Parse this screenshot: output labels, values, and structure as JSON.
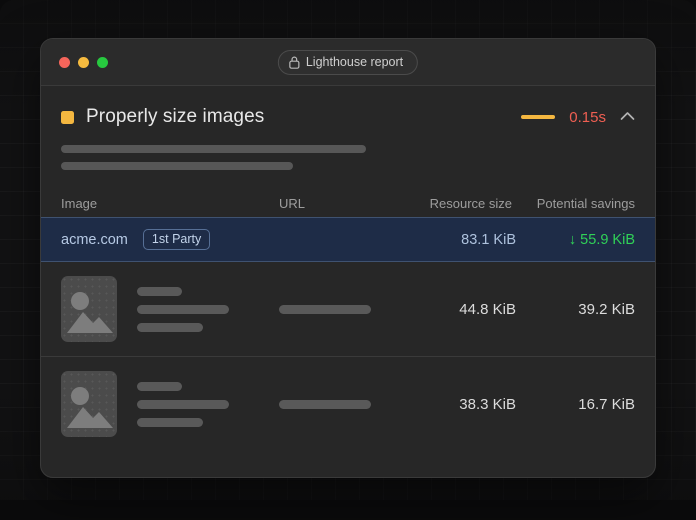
{
  "window": {
    "traffic_lights": [
      {
        "name": "close",
        "color": "#f5655b"
      },
      {
        "name": "minimize",
        "color": "#f6bb3f"
      },
      {
        "name": "zoom",
        "color": "#27c93f"
      }
    ],
    "url_pill": {
      "icon": "lock-icon",
      "label": "Lighthouse report"
    }
  },
  "audit": {
    "bullet_color": "#f4b740",
    "title": "Properly size images",
    "indicator_color": "#f4b740",
    "metric": "0.15s",
    "metric_color": "#ef5f52",
    "toggle_icon": "chevron-up-icon",
    "description_placeholder_lines": 2
  },
  "table": {
    "columns": {
      "image": "Image",
      "url": "URL",
      "resource_size": "Resource size",
      "potential_savings": "Potential savings"
    },
    "summary_row": {
      "host": "acme.com",
      "party_badge": "1st Party",
      "resource_size": "83.1 KiB",
      "potential_savings": "↓ 55.9 KiB",
      "savings_color": "#30d158",
      "background": "#1e2c47"
    },
    "rows": [
      {
        "thumbnail": "image-placeholder-icon",
        "resource_size": "44.8 KiB",
        "potential_savings": "39.2 KiB"
      },
      {
        "thumbnail": "image-placeholder-icon",
        "resource_size": "38.3 KiB",
        "potential_savings": "16.7 KiB"
      }
    ]
  }
}
